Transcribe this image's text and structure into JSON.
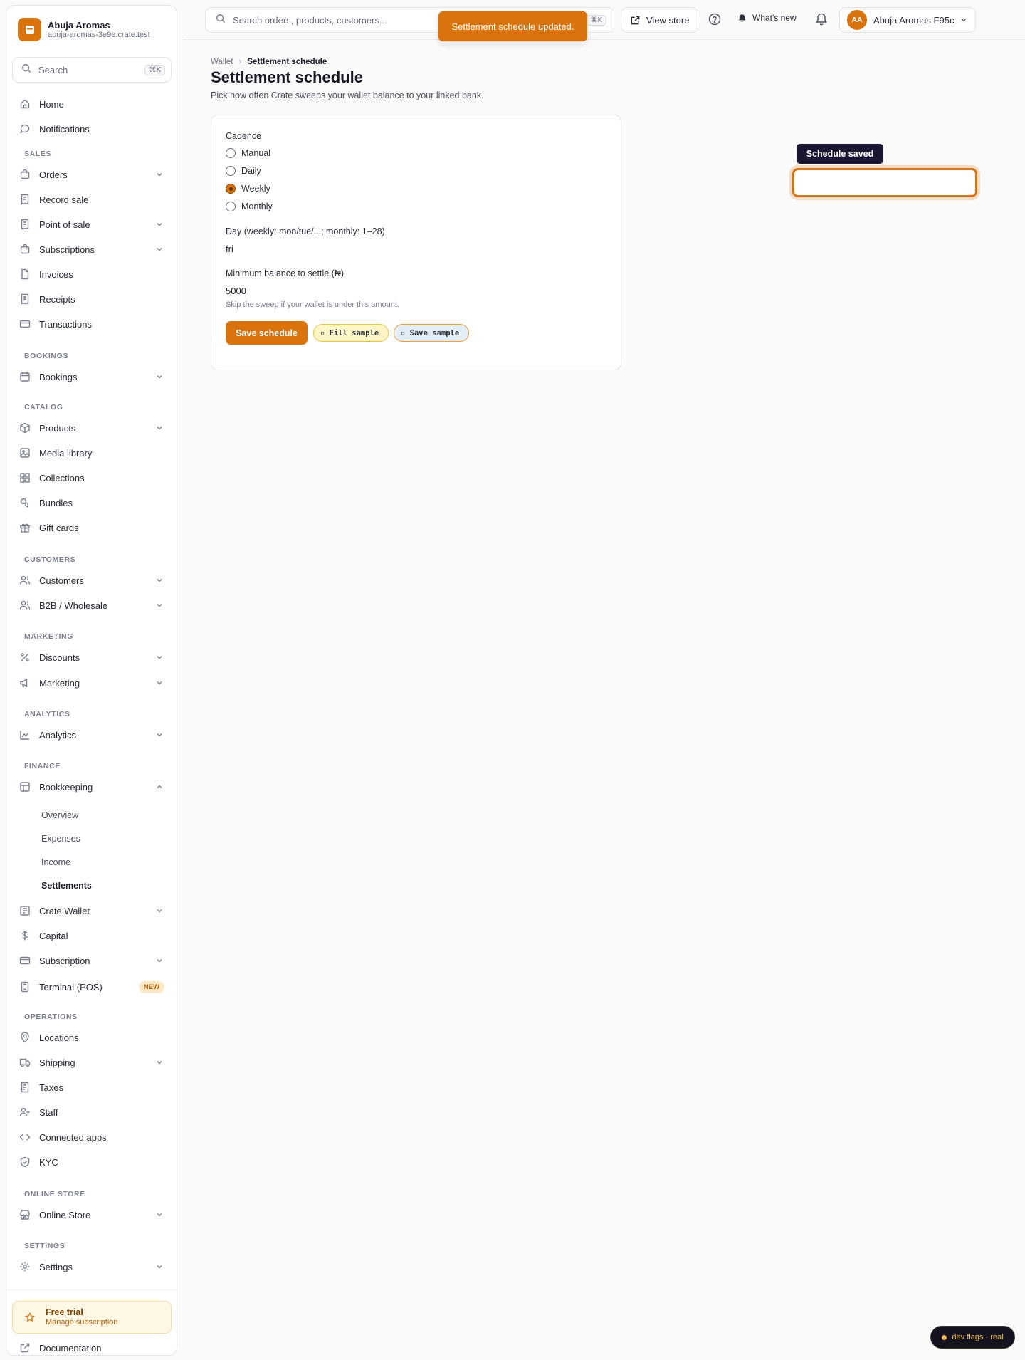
{
  "brand": {
    "name": "Abuja Aromas",
    "domain": "abuja-aromas-3e9e.crate.test"
  },
  "sidebar_search": {
    "label": "Search",
    "shortcut": "⌘K"
  },
  "nav": {
    "home": "Home",
    "notifications": "Notifications",
    "sec_sales": "SALES",
    "orders": "Orders",
    "record_sale": "Record sale",
    "pos": "Point of sale",
    "subscriptions": "Subscriptions",
    "invoices": "Invoices",
    "receipts": "Receipts",
    "transactions": "Transactions",
    "sec_bookings": "BOOKINGS",
    "bookings": "Bookings",
    "sec_catalog": "CATALOG",
    "products": "Products",
    "media": "Media library",
    "collections": "Collections",
    "bundles": "Bundles",
    "gift_cards": "Gift cards",
    "sec_customers": "CUSTOMERS",
    "customers": "Customers",
    "b2b": "B2B / Wholesale",
    "sec_marketing": "MARKETING",
    "discounts": "Discounts",
    "marketing": "Marketing",
    "sec_analytics": "ANALYTICS",
    "analytics": "Analytics",
    "sec_finance": "FINANCE",
    "bookkeeping": "Bookkeeping",
    "bk_overview": "Overview",
    "bk_expenses": "Expenses",
    "bk_income": "Income",
    "bk_settlements": "Settlements",
    "wallet": "Crate Wallet",
    "capital": "Capital",
    "subscription": "Subscription",
    "terminal": "Terminal (POS)",
    "terminal_badge": "NEW",
    "sec_operations": "OPERATIONS",
    "locations": "Locations",
    "shipping": "Shipping",
    "taxes": "Taxes",
    "staff": "Staff",
    "connected_apps": "Connected apps",
    "kyc": "KYC",
    "sec_online": "ONLINE STORE",
    "online_store": "Online Store",
    "sec_settings": "SETTINGS",
    "settings": "Settings"
  },
  "trial": {
    "title": "Free trial",
    "sub": "Manage subscription"
  },
  "documentation": "Documentation",
  "topbar": {
    "search_placeholder": "Search orders, products, customers...",
    "shortcut": "⌘K",
    "view_store": "View store",
    "whats_new": "What's new",
    "avatar_initials": "AA",
    "account_name": "Abuja Aromas F95c"
  },
  "toast": "Settlement schedule updated.",
  "breadcrumb": {
    "parent": "Wallet",
    "current": "Settlement schedule"
  },
  "page": {
    "title": "Settlement schedule",
    "subtitle": "Pick how often Crate sweeps your wallet balance to your linked bank."
  },
  "form": {
    "cadence_label": "Cadence",
    "options": [
      "Manual",
      "Daily",
      "Weekly",
      "Monthly"
    ],
    "selected": "Weekly",
    "day_label": "Day (weekly: mon/tue/...; monthly: 1–28)",
    "day_value": "fri",
    "min_label": "Minimum balance to settle (₦)",
    "min_value": "5000",
    "min_help": "Skip the sweep if your wallet is under this amount.",
    "save_button": "Save schedule",
    "fill_sample": "▫ Fill sample",
    "save_sample": "▫ Save sample"
  },
  "tooltip": "Schedule saved",
  "dev_flags": "dev flags · real",
  "colors": {
    "accent": "#d9730d",
    "tooltip_bg": "#1a1530"
  }
}
